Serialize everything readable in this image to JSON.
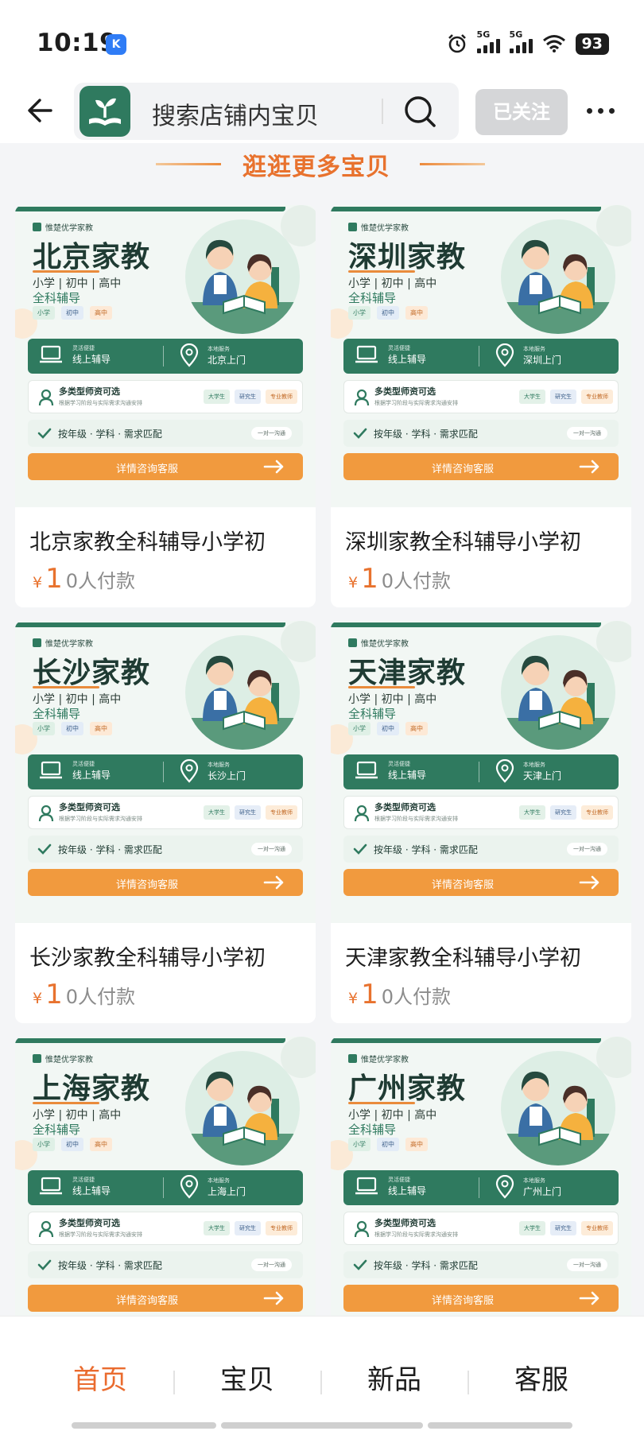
{
  "status_bar": {
    "time": "10:19",
    "badge": "K",
    "battery": "93",
    "net1": "5G",
    "net2": "5G"
  },
  "nav": {
    "search_placeholder": "搜索店铺内宝贝",
    "follow_label": "已关注"
  },
  "section": {
    "title": "逛逛更多宝贝"
  },
  "poster_common": {
    "brand": "惟楚优学家教",
    "levels": "小学 | 初中 | 高中",
    "subject": "全科辅导",
    "tags": [
      "小学",
      "初中",
      "高中"
    ],
    "online_small": "灵活便捷",
    "online_label": "线上辅导",
    "local_small": "本地服务",
    "teacher_main": "多类型师资可选",
    "teacher_sub": "根据学习阶段与实际需求沟通安排",
    "teacher_chips": [
      "大学生",
      "研究生",
      "专业教师"
    ],
    "match_text": "按年级 · 学科 · 需求匹配",
    "match_pill": "一对一沟通",
    "cta_label": "详情咨询客服"
  },
  "products": [
    {
      "poster_title": "北京家教",
      "local_label": "北京上门",
      "title": "北京家教全科辅导小学初",
      "currency": "¥",
      "price": "1",
      "sold": "0人付款"
    },
    {
      "poster_title": "深圳家教",
      "local_label": "深圳上门",
      "title": "深圳家教全科辅导小学初",
      "currency": "¥",
      "price": "1",
      "sold": "0人付款"
    },
    {
      "poster_title": "长沙家教",
      "local_label": "长沙上门",
      "title": "长沙家教全科辅导小学初",
      "currency": "¥",
      "price": "1",
      "sold": "0人付款"
    },
    {
      "poster_title": "天津家教",
      "local_label": "天津上门",
      "title": "天津家教全科辅导小学初",
      "currency": "¥",
      "price": "1",
      "sold": "0人付款"
    },
    {
      "poster_title": "上海家教",
      "local_label": "上海上门",
      "title": "",
      "currency": "",
      "price": "",
      "sold": ""
    },
    {
      "poster_title": "广州家教",
      "local_label": "广州上门",
      "title": "",
      "currency": "",
      "price": "",
      "sold": ""
    }
  ],
  "tabs": [
    {
      "label": "首页",
      "active": true
    },
    {
      "label": "宝贝",
      "active": false
    },
    {
      "label": "新品",
      "active": false
    },
    {
      "label": "客服",
      "active": false
    }
  ],
  "colors": {
    "brand_green": "#2f7a5f",
    "accent_orange": "#e8722e",
    "cta_orange": "#f19a3e",
    "follow_gray": "#d5d6d8"
  },
  "icons": {
    "back": "arrow-left-icon",
    "search": "search-icon",
    "more": "more-dots-icon",
    "laptop": "laptop-icon",
    "location": "location-pin-icon",
    "teacher": "person-icon",
    "check": "check-icon",
    "arrow": "arrow-right-icon"
  }
}
